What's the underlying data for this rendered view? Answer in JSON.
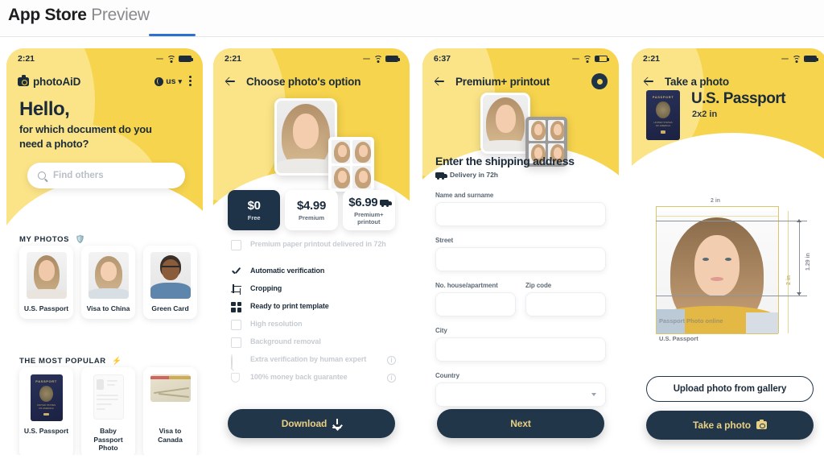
{
  "appstore": {
    "title_strong": "App Store",
    "title_light": "Preview"
  },
  "screens": [
    {
      "id": "home",
      "status_time": "2:21",
      "brand": "photoAiD",
      "locale": "us",
      "greeting": "Hello,",
      "subgreeting": "for which document do you need a photo?",
      "search_placeholder": "Find others",
      "section_my_photos": "MY PHOTOS",
      "section_my_photos_emoji": "🛡️",
      "my_photos": [
        {
          "label": "U.S. Passport"
        },
        {
          "label": "Visa to China"
        },
        {
          "label": "Green Card"
        }
      ],
      "section_popular": "THE MOST POPULAR",
      "section_popular_emoji": "⚡",
      "popular": [
        {
          "label": "U.S. Passport",
          "kind": "passport"
        },
        {
          "label": "Baby Passport Photo",
          "kind": "paper"
        },
        {
          "label": "Visa to Canada",
          "kind": "map"
        }
      ]
    },
    {
      "id": "choose-option",
      "status_time": "2:21",
      "nav_title": "Choose photo's option",
      "prices": [
        {
          "amount": "$0",
          "label": "Free",
          "selected": true,
          "truck": false
        },
        {
          "amount": "$4.99",
          "label": "Premium",
          "selected": false,
          "truck": false
        },
        {
          "amount": "$6.99",
          "label": "Premium+ printout",
          "selected": false,
          "truck": true
        }
      ],
      "features": [
        {
          "text": "Premium paper printout delivered in 72h",
          "enabled": false,
          "icon": "printer-icon",
          "info": false
        },
        {
          "text": "Automatic verification",
          "enabled": true,
          "icon": "check-icon",
          "info": false
        },
        {
          "text": "Cropping",
          "enabled": true,
          "icon": "crop-icon",
          "info": false
        },
        {
          "text": "Ready to print template",
          "enabled": true,
          "icon": "grid-icon",
          "info": false
        },
        {
          "text": "High resolution",
          "enabled": false,
          "icon": "image-icon",
          "info": false
        },
        {
          "text": "Background removal",
          "enabled": false,
          "icon": "background-icon",
          "info": false
        },
        {
          "text": "Extra verification by human expert",
          "enabled": false,
          "icon": "magnifier-icon",
          "info": true
        },
        {
          "text": "100% money back guarantee",
          "enabled": false,
          "icon": "shield-icon",
          "info": true
        }
      ],
      "cta": "Download"
    },
    {
      "id": "shipping",
      "status_time": "6:37",
      "nav_title": "Premium+ printout",
      "form_title": "Enter the shipping address",
      "delivery": "Delivery in 72h",
      "fields": [
        {
          "label": "Name and surname",
          "value": "",
          "type": "text"
        },
        {
          "label": "Street",
          "value": "",
          "type": "text"
        },
        {
          "label": "No. house/apartment",
          "value": "",
          "type": "text"
        },
        {
          "label": "Zip code",
          "value": "",
          "type": "text"
        },
        {
          "label": "City",
          "value": "",
          "type": "text"
        },
        {
          "label": "Country",
          "value": "",
          "type": "select"
        }
      ],
      "cta": "Next"
    },
    {
      "id": "take-photo",
      "status_time": "2:21",
      "nav_title": "Take a photo",
      "doc_title": "U.S. Passport",
      "doc_size": "2x2 in",
      "measure_width": "2 in",
      "measure_height": "2 in",
      "measure_head": "1.29 in",
      "watermark": "Passport Photo online",
      "photo_caption": "U.S. Passport",
      "cta_secondary": "Upload photo from gallery",
      "cta_primary": "Take a photo"
    }
  ],
  "colors": {
    "yellow": "#f6d44d",
    "yellow_light": "#fbe488",
    "navy": "#22364a",
    "navy_dark": "#1e3347",
    "gold_text": "#e7cf84",
    "muted": "#c7ccd2",
    "accent_blue": "#2f6fd0"
  }
}
